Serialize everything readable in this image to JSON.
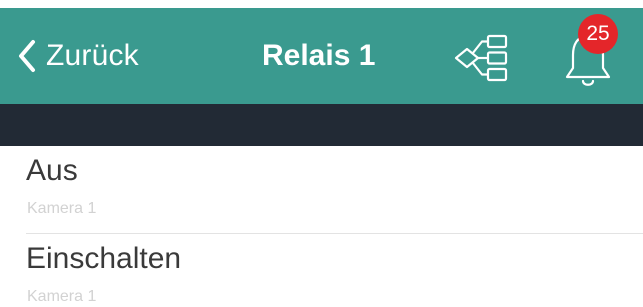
{
  "navbar": {
    "back_label": "Zurück",
    "title": "Relais 1",
    "hierarchy_icon": "hierarchy-icon",
    "bell_icon": "bell-icon",
    "notification_count": "25",
    "colors": {
      "accent": "#3a9a8f",
      "badge": "#e4262a"
    }
  },
  "list": {
    "items": [
      {
        "title": "Aus",
        "subtitle": "Kamera 1"
      },
      {
        "title": "Einschalten",
        "subtitle": "Kamera 1"
      }
    ]
  }
}
